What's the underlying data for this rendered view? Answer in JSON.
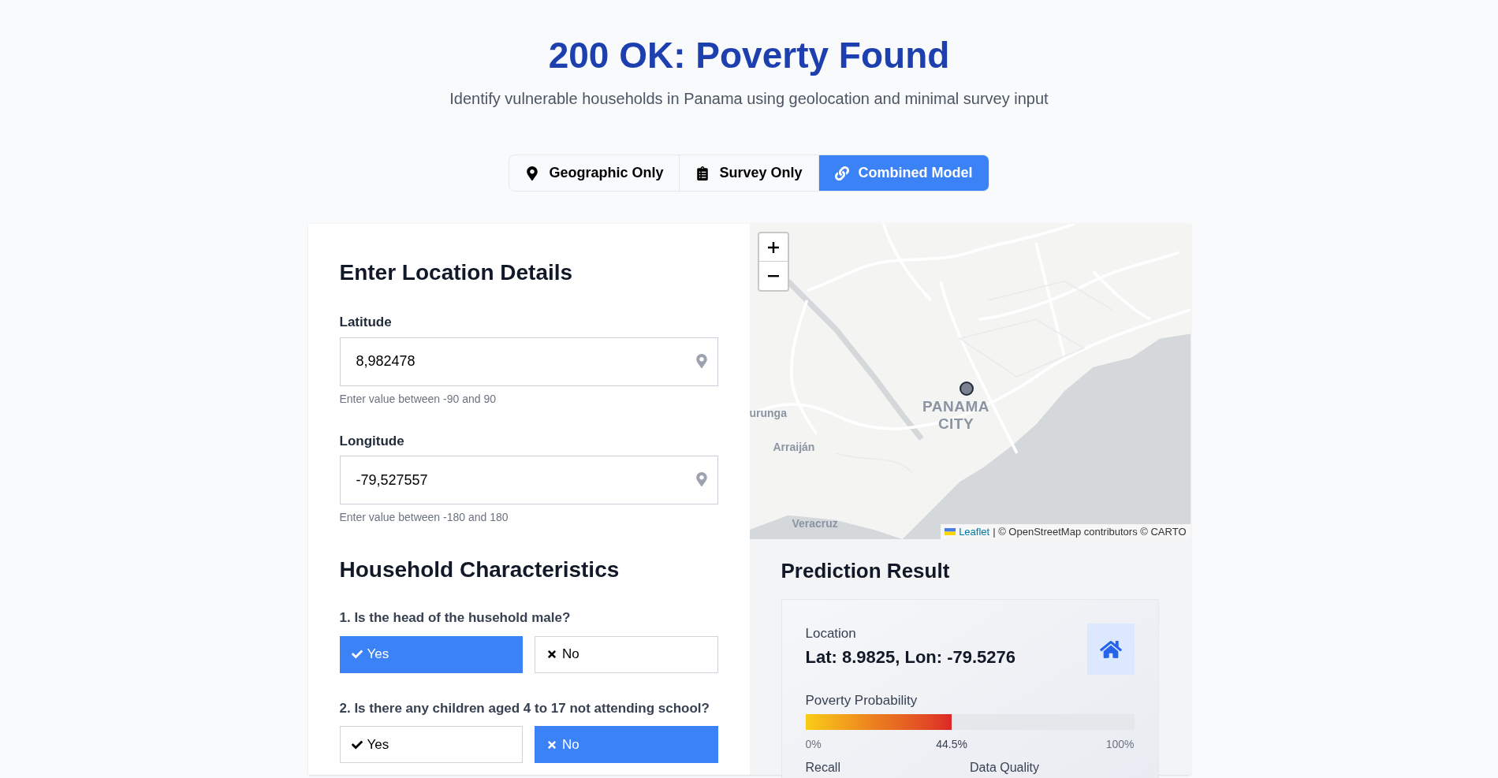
{
  "header": {
    "title": "200 OK: Poverty Found",
    "subtitle": "Identify vulnerable households in Panama using geolocation and minimal survey input"
  },
  "tabs": [
    {
      "label": "Geographic Only",
      "kind": "pin",
      "selected": false
    },
    {
      "label": "Survey Only",
      "kind": "clipboard",
      "selected": false
    },
    {
      "label": "Combined Model",
      "kind": "link",
      "selected": true
    }
  ],
  "location": {
    "heading": "Enter Location Details",
    "fields": [
      {
        "label": "Latitude",
        "value": "8,982478",
        "hint": "Enter value between -90 and 90"
      },
      {
        "label": "Longitude",
        "value": "-79,527557",
        "hint": "Enter value between -180 and 180"
      }
    ]
  },
  "household": {
    "heading": "Household Characteristics",
    "questions": [
      {
        "text": "1. Is the head of the husehold male?",
        "options": [
          {
            "label": "Yes",
            "kind": "yes",
            "selected": true
          },
          {
            "label": "No",
            "kind": "no",
            "selected": false
          }
        ]
      },
      {
        "text": "2. Is there any children aged 4 to 17 not attending school?",
        "options": [
          {
            "label": "Yes",
            "kind": "yes",
            "selected": false
          },
          {
            "label": "No",
            "kind": "no",
            "selected": true
          }
        ]
      }
    ]
  },
  "map": {
    "labels": [
      {
        "text": "urunga",
        "kind": "town"
      },
      {
        "text": "PANAMA CITY",
        "kind": "city"
      },
      {
        "text": "Arraiján",
        "kind": "town"
      },
      {
        "text": "Veracruz",
        "kind": "town"
      }
    ],
    "attribution": {
      "link": "Leaflet",
      "text": "| © OpenStreetMap contributors © CARTO"
    }
  },
  "prediction": {
    "heading": "Prediction Result",
    "location_label": "Location",
    "location_value": "Lat: 8.9825, Lon: -79.5276",
    "probability_label": "Poverty Probability",
    "level": 0.445,
    "scale": [
      "0%",
      "44.5%",
      "100%"
    ],
    "stats": [
      "Recall",
      "Data Quality"
    ]
  }
}
